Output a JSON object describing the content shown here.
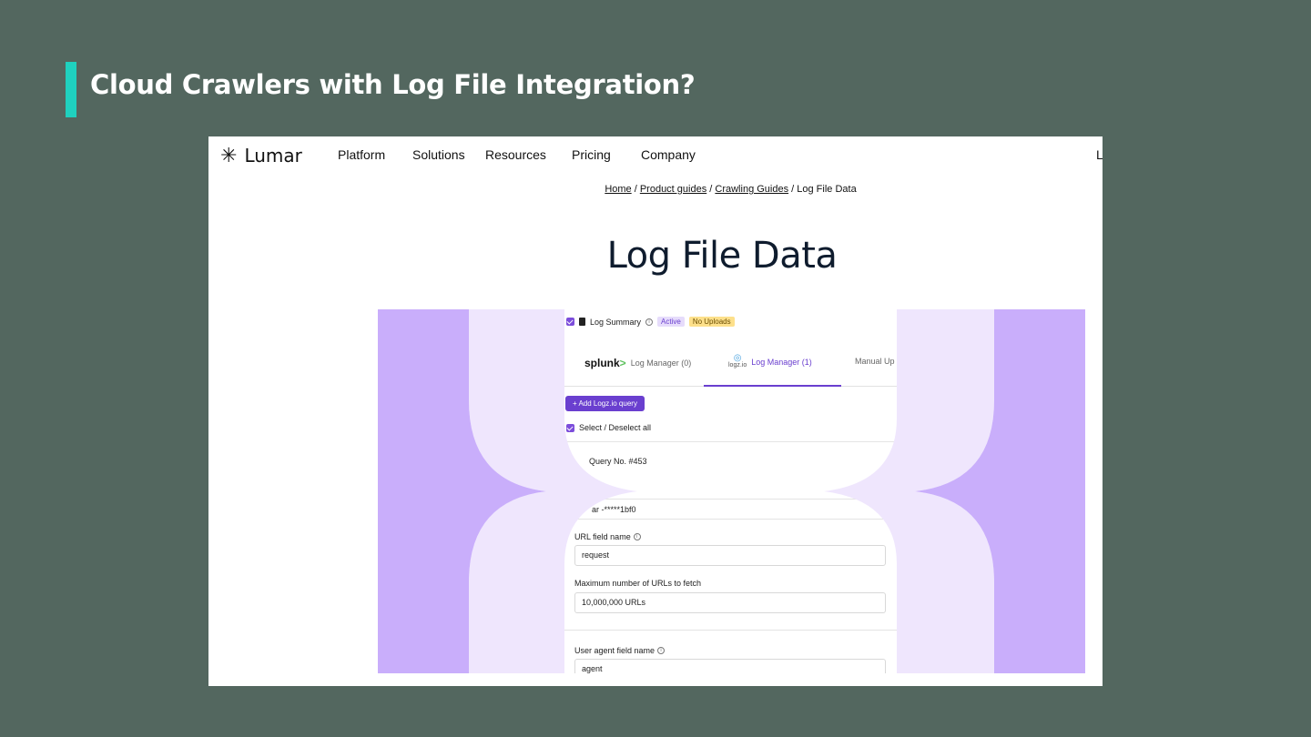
{
  "slide": {
    "title": "Cloud Crawlers with Log File Integration?"
  },
  "colors": {
    "background": "#53675f",
    "accent": "#1fd1bf",
    "purple": "#c9aefb",
    "lavender": "#efe6fd",
    "brand": "#6a3fcf"
  },
  "site": {
    "logo_text": "Lumar",
    "nav": [
      "Platform",
      "Solutions",
      "Resources",
      "Pricing",
      "Company"
    ],
    "nav_cut": "L",
    "breadcrumb": {
      "home": "Home",
      "sep1": " / ",
      "product_guides": "Product guides",
      "sep2": " / ",
      "crawling_guides": "Crawling Guides",
      "current": " / Log File Data"
    },
    "page_title": "Log File Data"
  },
  "panel": {
    "summary_label": "Log Summary",
    "badge_active": "Active",
    "badge_no_uploads": "No Uploads",
    "tab1_brand": "splunk",
    "tab1_brand_mark": ">",
    "tab1_label": "Log Manager (0)",
    "tab2_brand": "logz.io",
    "tab2_label": "Log Manager (1)",
    "tab3_label": "Manual Up",
    "add_button": "+  Add Logz.io query",
    "select_all": "Select / Deselect all",
    "query_no": "Query No. #453",
    "key_value": "ar -*****1bf0",
    "url_field_label": "URL field name",
    "url_field_value": "request",
    "max_urls_label": "Maximum number of URLs to fetch",
    "max_urls_value": "10,000,000 URLs",
    "user_agent_label": "User agent field name",
    "user_agent_value": "agent"
  }
}
